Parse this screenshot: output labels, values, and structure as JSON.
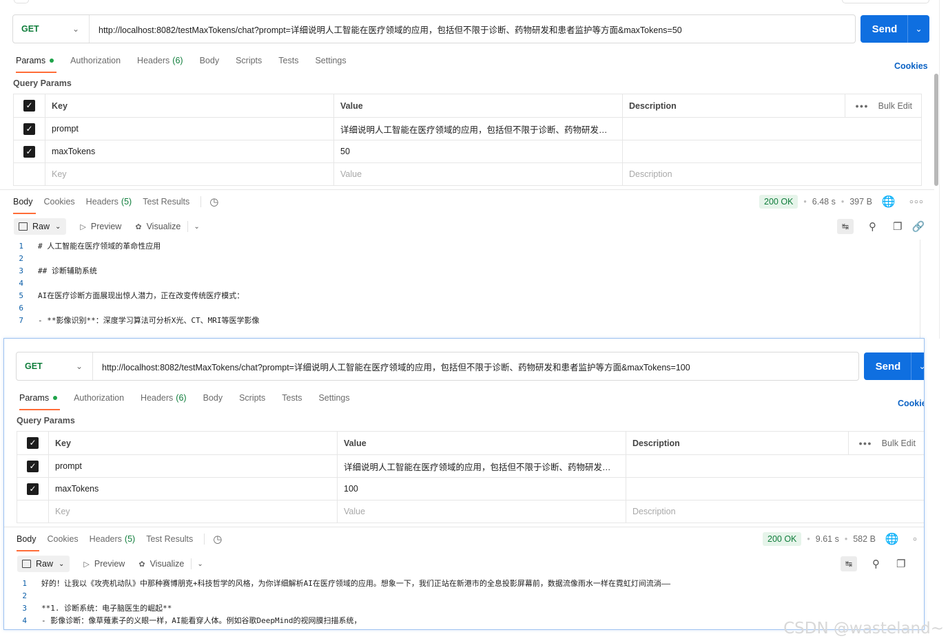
{
  "request1": {
    "method": "GET",
    "url": "http://localhost:8082/testMaxTokens/chat?prompt=详细说明人工智能在医疗领域的应用，包括但不限于诊断、药物研发和患者监护等方面&maxTokens=50",
    "send_label": "Send",
    "tabs": [
      {
        "label": "Params"
      },
      {
        "label": "Authorization"
      },
      {
        "label": "Headers",
        "count": "(6)"
      },
      {
        "label": "Body"
      },
      {
        "label": "Scripts"
      },
      {
        "label": "Tests"
      },
      {
        "label": "Settings"
      }
    ],
    "cookies_label": "Cookies",
    "query_params_label": "Query Params",
    "table": {
      "headers": {
        "key": "Key",
        "value": "Value",
        "description": "Description",
        "bulk_edit": "Bulk Edit"
      },
      "rows": [
        {
          "key": "prompt",
          "value": "详细说明人工智能在医疗领域的应用，包括但不限于诊断、药物研发和患者...",
          "description": ""
        },
        {
          "key": "maxTokens",
          "value": "50",
          "description": ""
        }
      ],
      "placeholder": {
        "key": "Key",
        "value": "Value",
        "description": "Description"
      }
    },
    "response": {
      "tabs": [
        {
          "label": "Body"
        },
        {
          "label": "Cookies"
        },
        {
          "label": "Headers",
          "count": "(5)"
        },
        {
          "label": "Test Results"
        }
      ],
      "status": "200 OK",
      "time": "6.48 s",
      "size": "397 B",
      "view": {
        "raw": "Raw",
        "preview": "Preview",
        "visualize": "Visualize"
      },
      "lines": [
        {
          "n": "1",
          "text": "# 人工智能在医疗领域的革命性应用"
        },
        {
          "n": "2",
          "text": ""
        },
        {
          "n": "3",
          "text": "## 诊断辅助系统"
        },
        {
          "n": "4",
          "text": ""
        },
        {
          "n": "5",
          "text": "AI在医疗诊断方面展现出惊人潜力，正在改变传统医疗模式："
        },
        {
          "n": "6",
          "text": ""
        },
        {
          "n": "7",
          "text": "- **影像识别**：深度学习算法可分析X光、CT、MRI等医学影像"
        }
      ]
    }
  },
  "request2": {
    "method": "GET",
    "url": "http://localhost:8082/testMaxTokens/chat?prompt=详细说明人工智能在医疗领域的应用，包括但不限于诊断、药物研发和患者监护等方面&maxTokens=100",
    "send_label": "Send",
    "tabs": [
      {
        "label": "Params"
      },
      {
        "label": "Authorization"
      },
      {
        "label": "Headers",
        "count": "(6)"
      },
      {
        "label": "Body"
      },
      {
        "label": "Scripts"
      },
      {
        "label": "Tests"
      },
      {
        "label": "Settings"
      }
    ],
    "cookies_label": "Cookie",
    "query_params_label": "Query Params",
    "table": {
      "headers": {
        "key": "Key",
        "value": "Value",
        "description": "Description",
        "bulk_edit": "Bulk Edit"
      },
      "rows": [
        {
          "key": "prompt",
          "value": "详细说明人工智能在医疗领域的应用，包括但不限于诊断、药物研发和患者...",
          "description": ""
        },
        {
          "key": "maxTokens",
          "value": "100",
          "description": ""
        }
      ],
      "placeholder": {
        "key": "Key",
        "value": "Value",
        "description": "Description"
      }
    },
    "response": {
      "tabs": [
        {
          "label": "Body"
        },
        {
          "label": "Cookies"
        },
        {
          "label": "Headers",
          "count": "(5)"
        },
        {
          "label": "Test Results"
        }
      ],
      "status": "200 OK",
      "time": "9.61 s",
      "size": "582 B",
      "view": {
        "raw": "Raw",
        "preview": "Preview",
        "visualize": "Visualize"
      },
      "lines": [
        {
          "n": "1",
          "text": "好的！让我以《攻壳机动队》中那种赛博朋克+科技哲学的风格，为你详细解析AI在医疗领域的应用。想象一下，我们正站在新港市的全息投影屏幕前，数据流像雨水一样在霓虹灯间流淌——"
        },
        {
          "n": "2",
          "text": ""
        },
        {
          "n": "3",
          "text": "**1. 诊断系统：电子脑医生的崛起**"
        },
        {
          "n": "4",
          "text": "- 影像诊断：像草薙素子的义眼一样，AI能看穿人体。例如谷歌DeepMind的视网膜扫描系统，"
        }
      ]
    }
  },
  "watermark": "CSDN @wasteland~",
  "colors": {
    "accent": "#ff6c37",
    "send": "#0f6fe0",
    "get": "#0f7d3b",
    "ok_bg": "#e6f4ea",
    "link": "#0b62c4"
  }
}
